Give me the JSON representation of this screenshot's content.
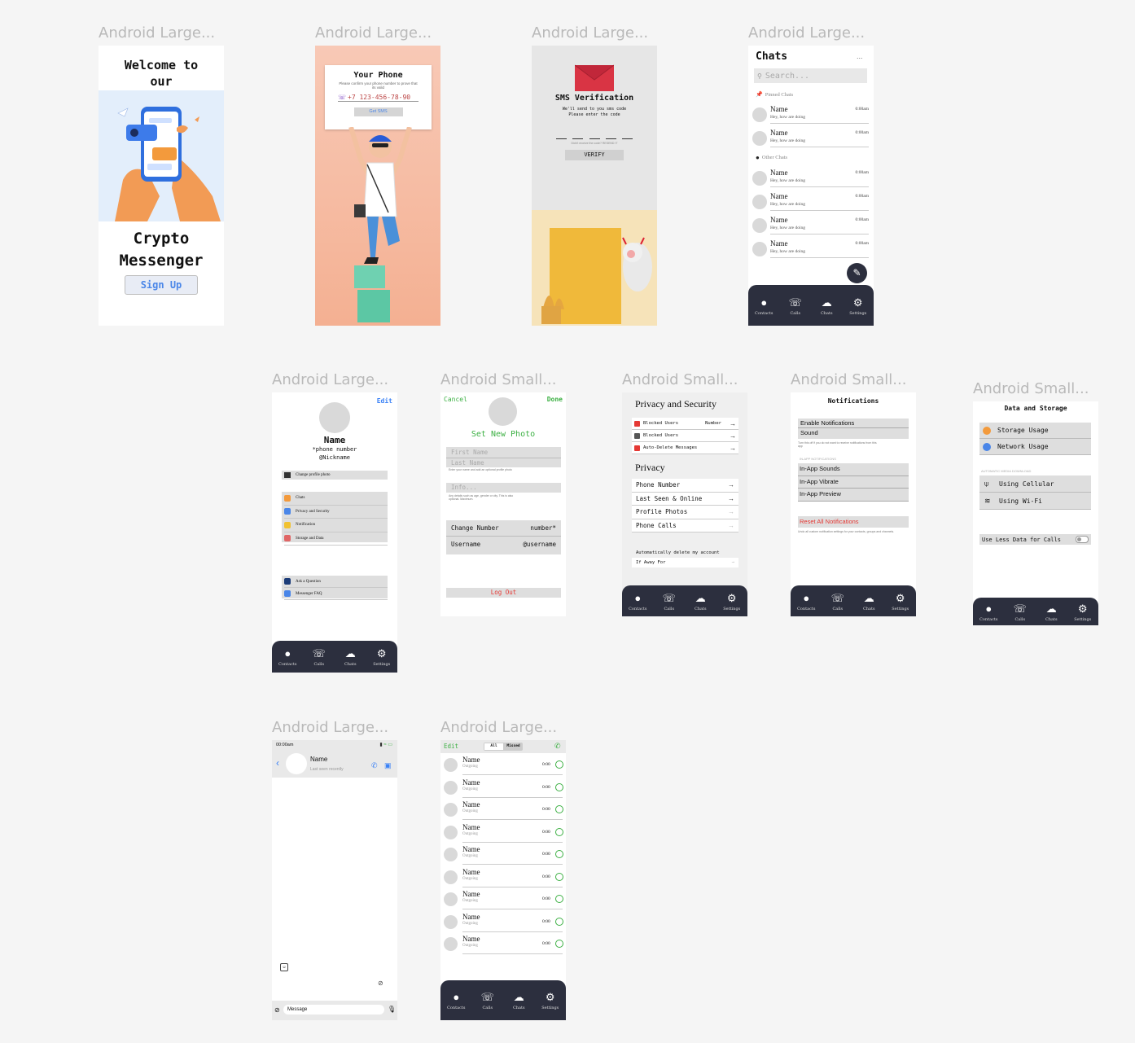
{
  "frame_labels": {
    "welcome": "Android Large...",
    "phone": "Android Large...",
    "sms": "Android Large...",
    "chats": "Android Large...",
    "settings": "Android Large...",
    "profile_edit": "Android Small...",
    "privacy": "Android Small...",
    "notifications": "Android Small...",
    "data_storage": "Android Small...",
    "chat_screen": "Android Large...",
    "calls": "Android Large..."
  },
  "nav": {
    "contacts": "Contacts",
    "calls": "Calls",
    "chats": "Chats",
    "settings": "Settings"
  },
  "welcome": {
    "title_line1": "Welcome to",
    "title_line2": "our",
    "app_line1": "Crypto",
    "app_line2": "Messenger",
    "signup": "Sign Up"
  },
  "phone": {
    "title": "Your Phone",
    "subtitle": "Please confirm your phone number to prove that its valid",
    "number": "+7 123-456-78-90",
    "get_sms": "Get SMS"
  },
  "sms": {
    "title": "SMS Verification",
    "subtitle_line1": "We'll send to you sms code",
    "subtitle_line2": "Please enter the code",
    "resend": "Didn't receive the code? RESEND IT",
    "verify": "VERIFY"
  },
  "chats": {
    "title": "Chats",
    "more": "...",
    "search_placeholder": "Search...",
    "pinned_header": "Pinned Chats",
    "other_header": "Other Chats",
    "pinned": [
      {
        "name": "Name",
        "message": "Hey, how are doing",
        "time": "0:00am"
      },
      {
        "name": "Name",
        "message": "Hey, how are doing",
        "time": "0:00am"
      }
    ],
    "other": [
      {
        "name": "Name",
        "message": "Hey, how are doing",
        "time": "0:00am"
      },
      {
        "name": "Name",
        "message": "Hey, how are doing",
        "time": "0:00am"
      },
      {
        "name": "Name",
        "message": "Hey, how are doing",
        "time": "0:00am"
      },
      {
        "name": "Name",
        "message": "Hey, how are doing",
        "time": "0:00am"
      }
    ]
  },
  "settings": {
    "edit": "Edit",
    "name": "Name",
    "phone": "*phone number",
    "nickname": "@Nickname",
    "change_photo": "Change profile photo",
    "group1": [
      "Chats",
      "Privacy and Security",
      "Notification",
      "Storage and Data"
    ],
    "group2": [
      "Ask a Question",
      "Messenger FAQ"
    ]
  },
  "profile_edit": {
    "cancel": "Cancel",
    "done": "Done",
    "set_photo": "Set New Photo",
    "first_name": "First Name",
    "last_name": "Last  Name",
    "name_hint": "Enter your name and add an optional profile photo",
    "info": "Info...",
    "info_hint": "Any details such as age, gender or city. This is also optional. Maximum.",
    "change_number": "Change Number",
    "number_value": "number*",
    "username": "Username",
    "username_value": "@username",
    "logout": "Log Out"
  },
  "privacy": {
    "title": "Privacy and Security",
    "items": [
      {
        "label": "Blocked Users",
        "value": "Number"
      },
      {
        "label": "Blocked Users",
        "value": ""
      },
      {
        "label": "Auto-Delete Messages",
        "value": ""
      }
    ],
    "privacy_header": "Privacy",
    "privacy_items": [
      "Phone Number",
      "Last Seen & Online",
      "Profile Photos",
      "Phone Calls"
    ],
    "auto_delete": "Automatically delete my account",
    "away_for": "If Away For"
  },
  "notifications": {
    "title": "Notifications",
    "enable": "Enable Notifications",
    "sound": "Sound",
    "hint": "Turn this off if you do not want to receive notifications from this app",
    "in_app_header": "IN-APP NOTIFICATIONS",
    "in_app": [
      "In-App Sounds",
      "In-App Vibrate",
      "In-App Preview"
    ],
    "reset": "Reset All Notifications",
    "reset_hint": "Undo all custom notification settings for your contacts, groups and channels."
  },
  "data_storage": {
    "title": "Data and Storage",
    "usage": [
      "Storage Usage",
      "Network Usage"
    ],
    "auto_header": "AUTOMATIC MEDIA DOWNLOAD",
    "auto": [
      "Using Cellular",
      "Using Wi-Fi"
    ],
    "less_data": "Use Less Data for Calls"
  },
  "chat_screen": {
    "time": "00:00am",
    "name": "Name",
    "status": "Last seen recently",
    "message_placeholder": "Message"
  },
  "calls": {
    "edit": "Edit",
    "tab_all": "All",
    "tab_missed": "Missed",
    "items": [
      {
        "name": "Name",
        "type": "Outgoing",
        "time": "0:00"
      },
      {
        "name": "Name",
        "type": "Outgoing",
        "time": "0:00"
      },
      {
        "name": "Name",
        "type": "Outgoing",
        "time": "0:00"
      },
      {
        "name": "Name",
        "type": "Outgoing",
        "time": "0:00"
      },
      {
        "name": "Name",
        "type": "Outgoing",
        "time": "0:00"
      },
      {
        "name": "Name",
        "type": "Outgoing",
        "time": "0:00"
      },
      {
        "name": "Name",
        "type": "Outgoing",
        "time": "0:00"
      },
      {
        "name": "Name",
        "type": "Outgoing",
        "time": "0:00"
      },
      {
        "name": "Name",
        "type": "Outgoing",
        "time": "0:00"
      }
    ]
  },
  "colors": {
    "nav_bg": "#2c2f3e",
    "accent_blue": "#3b82f6",
    "accent_green": "#3cb043",
    "reset_red": "#e53935"
  }
}
